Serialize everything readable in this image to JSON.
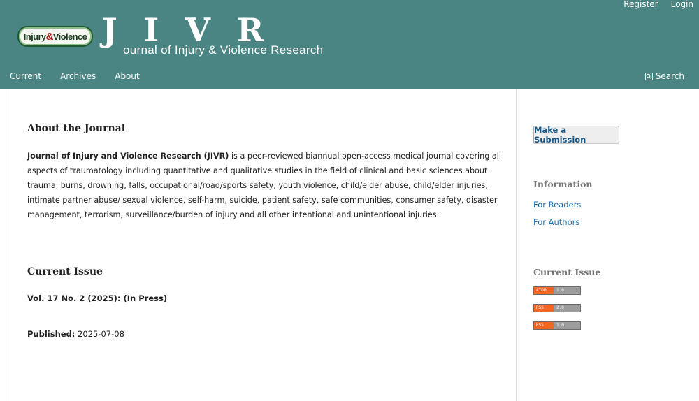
{
  "header": {
    "user_nav": {
      "register": "Register",
      "login": "Login"
    },
    "logo": {
      "word1": "Injury",
      "amp": "&",
      "word2": "Violence"
    },
    "brand": {
      "initials": "JIVR",
      "subtitle": "ournal of Injury & Violence Research"
    },
    "nav": {
      "current": "Current",
      "archives": "Archives",
      "about": "About"
    },
    "search": {
      "label": "Search",
      "icon": "search-icon"
    },
    "background_color": "#4a8583"
  },
  "main": {
    "about": {
      "title": "About the Journal",
      "journal_name": "Journal of Injury and Violence Research (JIVR)",
      "description": " is a peer-reviewed biannual open-access medical journal covering all aspects of traumatology including quantitative and qualitative studies in the field of clinical and basic sciences about trauma, burns, drowning, falls, occupational/road/sports safety, youth violence, child/elder abuse, child/elder injuries, intimate partner abuse/ sexual violence, self-harm, suicide, patient safety, safe communities, consumer safety, disaster management, terrorism, surveillance/burden of injury and all other intentional and unintentional injuries."
    },
    "current_issue": {
      "title": "Current Issue",
      "volume": "Vol. 17 No. 2 (2025): (In Press)",
      "published_label": "Published:",
      "published_date": " 2025-07-08"
    }
  },
  "sidebar": {
    "submit_label": "Make a Submission",
    "information": {
      "title": "Information",
      "readers": "For Readers",
      "authors": "For Authors"
    },
    "current_issue": {
      "title": "Current Issue",
      "feeds": [
        {
          "label": "ATOM",
          "version": "1.0"
        },
        {
          "label": "RSS",
          "version": "2.0"
        },
        {
          "label": "RSS",
          "version": "1.0"
        }
      ]
    }
  }
}
